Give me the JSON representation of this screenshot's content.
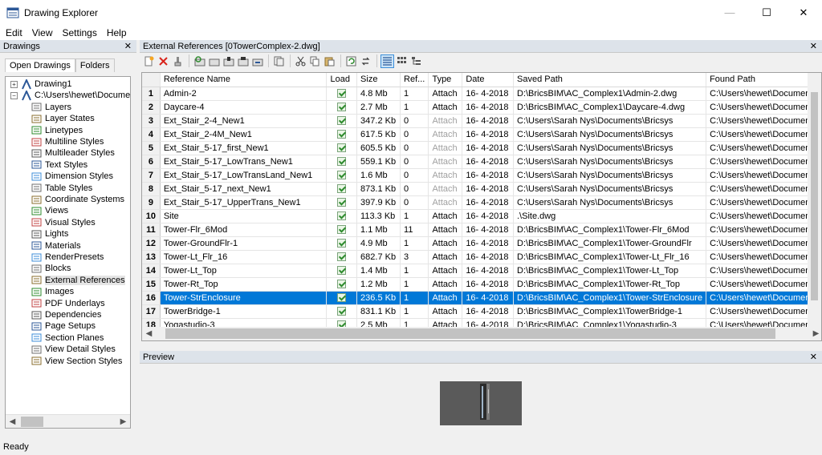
{
  "window": {
    "title": "Drawing Explorer",
    "minimize": "—",
    "maximize": "☐",
    "close": "✕"
  },
  "menu": [
    "Edit",
    "View",
    "Settings",
    "Help"
  ],
  "left_panel": {
    "title": "Drawings",
    "close": "✕",
    "tabs": [
      "Open Drawings",
      "Folders"
    ],
    "tree": [
      {
        "label": "Drawing1",
        "level": 0,
        "expander": "+",
        "icon": "drawing-icon"
      },
      {
        "label": "C:\\Users\\hewet\\Documents",
        "level": 0,
        "expander": "−",
        "icon": "drawing-icon"
      },
      {
        "label": "Layers",
        "level": 1,
        "icon": "layers-icon"
      },
      {
        "label": "Layer States",
        "level": 1,
        "icon": "layer-states-icon"
      },
      {
        "label": "Linetypes",
        "level": 1,
        "icon": "linetypes-icon"
      },
      {
        "label": "Multiline Styles",
        "level": 1,
        "icon": "multiline-styles-icon"
      },
      {
        "label": "Multileader Styles",
        "level": 1,
        "icon": "multileader-styles-icon"
      },
      {
        "label": "Text Styles",
        "level": 1,
        "icon": "text-styles-icon"
      },
      {
        "label": "Dimension Styles",
        "level": 1,
        "icon": "dimension-styles-icon"
      },
      {
        "label": "Table Styles",
        "level": 1,
        "icon": "table-styles-icon"
      },
      {
        "label": "Coordinate Systems",
        "level": 1,
        "icon": "coordinate-systems-icon"
      },
      {
        "label": "Views",
        "level": 1,
        "icon": "views-icon"
      },
      {
        "label": "Visual Styles",
        "level": 1,
        "icon": "visual-styles-icon"
      },
      {
        "label": "Lights",
        "level": 1,
        "icon": "lights-icon"
      },
      {
        "label": "Materials",
        "level": 1,
        "icon": "materials-icon"
      },
      {
        "label": "RenderPresets",
        "level": 1,
        "icon": "render-presets-icon"
      },
      {
        "label": "Blocks",
        "level": 1,
        "icon": "blocks-icon"
      },
      {
        "label": "External References",
        "level": 1,
        "icon": "external-references-icon",
        "selected": true
      },
      {
        "label": "Images",
        "level": 1,
        "icon": "images-icon"
      },
      {
        "label": "PDF Underlays",
        "level": 1,
        "icon": "pdf-underlays-icon"
      },
      {
        "label": "Dependencies",
        "level": 1,
        "icon": "dependencies-icon"
      },
      {
        "label": "Page Setups",
        "level": 1,
        "icon": "page-setups-icon"
      },
      {
        "label": "Section Planes",
        "level": 1,
        "icon": "section-planes-icon"
      },
      {
        "label": "View Detail Styles",
        "level": 1,
        "icon": "view-detail-styles-icon"
      },
      {
        "label": "View Section Styles",
        "level": 1,
        "icon": "view-section-styles-icon"
      }
    ]
  },
  "main_panel": {
    "title": "External References [0TowerComplex-2.dwg]",
    "close": "✕",
    "columns": [
      "Reference Name",
      "Load",
      "Size",
      "Ref...",
      "Type",
      "Date",
      "Saved Path",
      "Found Path"
    ],
    "rows": [
      {
        "n": "1",
        "name": "Admin-2",
        "size": "4.8 Mb",
        "ref": "1",
        "type": "Attach",
        "date": "16- 4-2018",
        "saved": "D:\\BricsBIM\\AC_Complex1\\Admin-2.dwg",
        "found": "C:\\Users\\hewet\\Documents"
      },
      {
        "n": "2",
        "name": "Daycare-4",
        "size": "2.7 Mb",
        "ref": "1",
        "type": "Attach",
        "date": "16- 4-2018",
        "saved": "D:\\BricsBIM\\AC_Complex1\\Daycare-4.dwg",
        "found": "C:\\Users\\hewet\\Documents"
      },
      {
        "n": "3",
        "name": "Ext_Stair_2-4_New1",
        "size": "347.2 Kb",
        "ref": "0",
        "type": "Attach",
        "dim": true,
        "date": "16- 4-2018",
        "saved": "C:\\Users\\Sarah Nys\\Documents\\Bricsys",
        "found": "C:\\Users\\hewet\\Documents"
      },
      {
        "n": "4",
        "name": "Ext_Stair_2-4M_New1",
        "size": "617.5 Kb",
        "ref": "0",
        "type": "Attach",
        "dim": true,
        "date": "16- 4-2018",
        "saved": "C:\\Users\\Sarah Nys\\Documents\\Bricsys",
        "found": "C:\\Users\\hewet\\Documents"
      },
      {
        "n": "5",
        "name": "Ext_Stair_5-17_first_New1",
        "size": "605.5 Kb",
        "ref": "0",
        "type": "Attach",
        "dim": true,
        "date": "16- 4-2018",
        "saved": "C:\\Users\\Sarah Nys\\Documents\\Bricsys",
        "found": "C:\\Users\\hewet\\Documents"
      },
      {
        "n": "6",
        "name": "Ext_Stair_5-17_LowTrans_New1",
        "size": "559.1 Kb",
        "ref": "0",
        "type": "Attach",
        "dim": true,
        "date": "16- 4-2018",
        "saved": "C:\\Users\\Sarah Nys\\Documents\\Bricsys",
        "found": "C:\\Users\\hewet\\Documents"
      },
      {
        "n": "7",
        "name": "Ext_Stair_5-17_LowTransLand_New1",
        "size": "1.6 Mb",
        "ref": "0",
        "type": "Attach",
        "dim": true,
        "date": "16- 4-2018",
        "saved": "C:\\Users\\Sarah Nys\\Documents\\Bricsys",
        "found": "C:\\Users\\hewet\\Documents"
      },
      {
        "n": "8",
        "name": "Ext_Stair_5-17_next_New1",
        "size": "873.1 Kb",
        "ref": "0",
        "type": "Attach",
        "dim": true,
        "date": "16- 4-2018",
        "saved": "C:\\Users\\Sarah Nys\\Documents\\Bricsys",
        "found": "C:\\Users\\hewet\\Documents"
      },
      {
        "n": "9",
        "name": "Ext_Stair_5-17_UpperTrans_New1",
        "size": "397.9 Kb",
        "ref": "0",
        "type": "Attach",
        "dim": true,
        "date": "16- 4-2018",
        "saved": "C:\\Users\\Sarah Nys\\Documents\\Bricsys",
        "found": "C:\\Users\\hewet\\Documents"
      },
      {
        "n": "10",
        "name": "Site",
        "size": "113.3 Kb",
        "ref": "1",
        "type": "Attach",
        "date": "16- 4-2018",
        "saved": ".\\Site.dwg",
        "found": "C:\\Users\\hewet\\Documents"
      },
      {
        "n": "11",
        "name": "Tower-Flr_6Mod",
        "size": "1.1 Mb",
        "ref": "11",
        "type": "Attach",
        "date": "16- 4-2018",
        "saved": "D:\\BricsBIM\\AC_Complex1\\Tower-Flr_6Mod",
        "found": "C:\\Users\\hewet\\Documents"
      },
      {
        "n": "12",
        "name": "Tower-GroundFlr-1",
        "size": "4.9 Mb",
        "ref": "1",
        "type": "Attach",
        "date": "16- 4-2018",
        "saved": "D:\\BricsBIM\\AC_Complex1\\Tower-GroundFlr",
        "found": "C:\\Users\\hewet\\Documents"
      },
      {
        "n": "13",
        "name": "Tower-Lt_Flr_16",
        "size": "682.7 Kb",
        "ref": "3",
        "type": "Attach",
        "date": "16- 4-2018",
        "saved": "D:\\BricsBIM\\AC_Complex1\\Tower-Lt_Flr_16",
        "found": "C:\\Users\\hewet\\Documents"
      },
      {
        "n": "14",
        "name": "Tower-Lt_Top",
        "size": "1.4 Mb",
        "ref": "1",
        "type": "Attach",
        "date": "16- 4-2018",
        "saved": "D:\\BricsBIM\\AC_Complex1\\Tower-Lt_Top",
        "found": "C:\\Users\\hewet\\Documents"
      },
      {
        "n": "15",
        "name": "Tower-Rt_Top",
        "size": "1.2 Mb",
        "ref": "1",
        "type": "Attach",
        "date": "16- 4-2018",
        "saved": "D:\\BricsBIM\\AC_Complex1\\Tower-Rt_Top",
        "found": "C:\\Users\\hewet\\Documents"
      },
      {
        "n": "16",
        "name": "Tower-StrEnclosure",
        "size": "236.5 Kb",
        "ref": "1",
        "type": "Attach",
        "date": "16- 4-2018",
        "saved": "D:\\BricsBIM\\AC_Complex1\\Tower-StrEnclosure",
        "found": "C:\\Users\\hewet\\Documents",
        "selected": true
      },
      {
        "n": "17",
        "name": "TowerBridge-1",
        "size": "831.1 Kb",
        "ref": "1",
        "type": "Attach",
        "date": "16- 4-2018",
        "saved": "D:\\BricsBIM\\AC_Complex1\\TowerBridge-1",
        "found": "C:\\Users\\hewet\\Documents"
      },
      {
        "n": "18",
        "name": "Yogastudio-3",
        "size": "2.5 Mb",
        "ref": "1",
        "type": "Attach",
        "date": "16- 4-2018",
        "saved": "D:\\BricsBIM\\AC_Complex1\\Yogastudio-3",
        "found": "C:\\Users\\hewet\\Documents"
      }
    ]
  },
  "preview": {
    "title": "Preview",
    "close": "✕"
  },
  "status": {
    "text": "Ready"
  },
  "colors": {
    "selection": "#0078d7",
    "header_bg": "#dde3ea",
    "load_check": "#2e8b2e"
  }
}
